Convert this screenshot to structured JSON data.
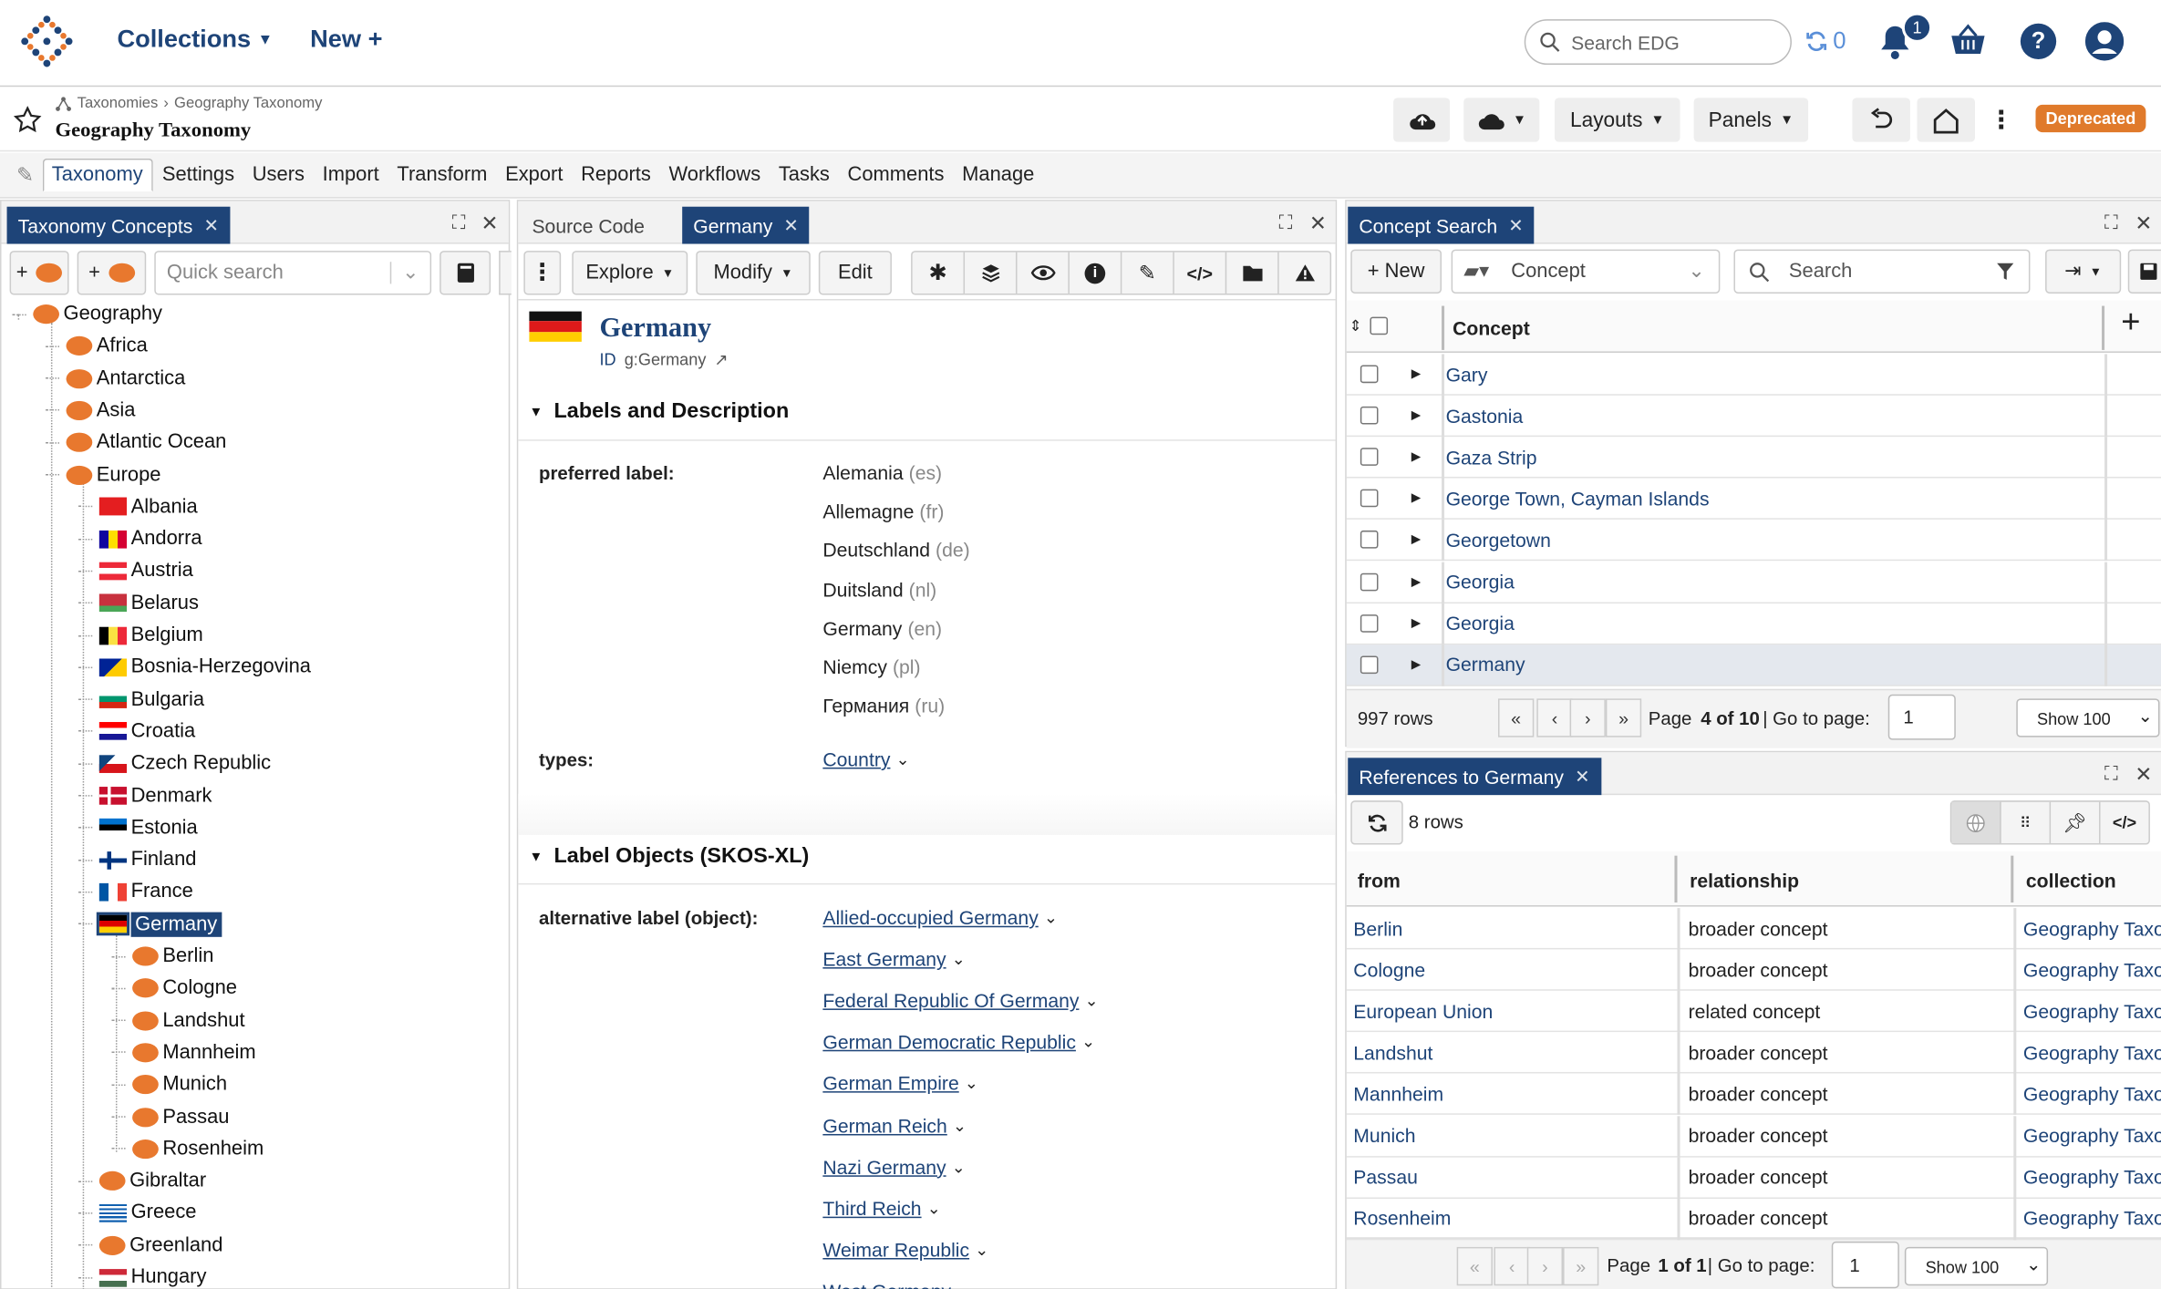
{
  "topbar": {
    "collections_label": "Collections",
    "new_label": "New +",
    "search_placeholder": "Search EDG",
    "sync_count": "0",
    "notification_count": "1"
  },
  "titlebar": {
    "breadcrumb": [
      "Taxonomies",
      "Geography Taxonomy"
    ],
    "title": "Geography Taxonomy",
    "layouts_label": "Layouts",
    "panels_label": "Panels",
    "status_badge": "Deprecated"
  },
  "menubar": {
    "items": [
      "Taxonomy",
      "Settings",
      "Users",
      "Import",
      "Transform",
      "Export",
      "Reports",
      "Workflows",
      "Tasks",
      "Comments",
      "Manage"
    ]
  },
  "tree_panel": {
    "tab_label": "Taxonomy Concepts",
    "quick_search_placeholder": "Quick search",
    "nodes": [
      {
        "label": "Geography",
        "icon": "concept",
        "level": 0
      },
      {
        "label": "Africa",
        "icon": "concept",
        "level": 1
      },
      {
        "label": "Antarctica",
        "icon": "concept",
        "level": 1
      },
      {
        "label": "Asia",
        "icon": "concept",
        "level": 1
      },
      {
        "label": "Atlantic Ocean",
        "icon": "concept",
        "level": 1
      },
      {
        "label": "Europe",
        "icon": "concept",
        "level": 1
      },
      {
        "label": "Albania",
        "icon": "flag-albania",
        "level": 2
      },
      {
        "label": "Andorra",
        "icon": "flag-andorra",
        "level": 2
      },
      {
        "label": "Austria",
        "icon": "flag-austria",
        "level": 2
      },
      {
        "label": "Belarus",
        "icon": "flag-belarus",
        "level": 2
      },
      {
        "label": "Belgium",
        "icon": "flag-belgium",
        "level": 2
      },
      {
        "label": "Bosnia-Herzegovina",
        "icon": "flag-bosnia",
        "level": 2
      },
      {
        "label": "Bulgaria",
        "icon": "flag-bulgaria",
        "level": 2
      },
      {
        "label": "Croatia",
        "icon": "flag-croatia",
        "level": 2
      },
      {
        "label": "Czech Republic",
        "icon": "flag-czech",
        "level": 2
      },
      {
        "label": "Denmark",
        "icon": "flag-denmark",
        "level": 2
      },
      {
        "label": "Estonia",
        "icon": "flag-estonia",
        "level": 2
      },
      {
        "label": "Finland",
        "icon": "flag-finland",
        "level": 2
      },
      {
        "label": "France",
        "icon": "flag-france",
        "level": 2
      },
      {
        "label": "Germany",
        "icon": "flag-germany",
        "level": 2,
        "selected": true
      },
      {
        "label": "Berlin",
        "icon": "concept",
        "level": 3
      },
      {
        "label": "Cologne",
        "icon": "concept",
        "level": 3
      },
      {
        "label": "Landshut",
        "icon": "concept",
        "level": 3
      },
      {
        "label": "Mannheim",
        "icon": "concept",
        "level": 3
      },
      {
        "label": "Munich",
        "icon": "concept",
        "level": 3
      },
      {
        "label": "Passau",
        "icon": "concept",
        "level": 3
      },
      {
        "label": "Rosenheim",
        "icon": "concept",
        "level": 3
      },
      {
        "label": "Gibraltar",
        "icon": "concept",
        "level": 2
      },
      {
        "label": "Greece",
        "icon": "flag-greece",
        "level": 2
      },
      {
        "label": "Greenland",
        "icon": "concept",
        "level": 2
      },
      {
        "label": "Hungary",
        "icon": "flag-hungary",
        "level": 2
      }
    ]
  },
  "detail_panel": {
    "tabs": [
      "Source Code",
      "Germany"
    ],
    "toolbar": {
      "explore": "Explore",
      "modify": "Modify",
      "edit": "Edit"
    },
    "resource_title": "Germany",
    "resource_id_label": "ID",
    "resource_id": "g:Germany",
    "section_labels": "Labels and Description",
    "preferred_label_name": "preferred label:",
    "preferred_labels": [
      {
        "text": "Alemania",
        "lang": "(es)"
      },
      {
        "text": "Allemagne",
        "lang": "(fr)"
      },
      {
        "text": "Deutschland",
        "lang": "(de)"
      },
      {
        "text": "Duitsland",
        "lang": "(nl)"
      },
      {
        "text": "Germany",
        "lang": "(en)"
      },
      {
        "text": "Niemcy",
        "lang": "(pl)"
      },
      {
        "text": "Германия",
        "lang": "(ru)"
      }
    ],
    "types_name": "types:",
    "types_value": "Country",
    "section_label_objects": "Label Objects (SKOS-XL)",
    "alt_label_name": "alternative label (object):",
    "alt_labels": [
      "Allied-occupied Germany",
      "East Germany",
      "Federal Republic Of Germany",
      "German Democratic Republic",
      "German Empire",
      "German Reich",
      "Nazi Germany",
      "Third Reich",
      "Weimar Republic",
      "West Germany"
    ]
  },
  "concept_search": {
    "tab_label": "Concept Search",
    "new_label": "+ New",
    "type_select": "Concept",
    "search_placeholder": "Search",
    "column_header": "Concept",
    "rows": [
      "Gary",
      "Gastonia",
      "Gaza Strip",
      "George Town, Cayman Islands",
      "Georgetown",
      "Georgia",
      "Georgia",
      "Germany"
    ],
    "row_count": "997 rows",
    "page_prefix": "Page",
    "page_info": "4 of 10",
    "goto_label": "| Go to page:",
    "goto_value": "1",
    "show_label": "Show 100"
  },
  "references": {
    "tab_label": "References to Germany",
    "row_count": "8 rows",
    "columns": [
      "from",
      "relationship",
      "collection"
    ],
    "rows": [
      {
        "from": "Berlin",
        "relationship": "broader concept",
        "collection": "Geography Taxonomy"
      },
      {
        "from": "Cologne",
        "relationship": "broader concept",
        "collection": "Geography Taxonomy"
      },
      {
        "from": "European Union",
        "relationship": "related concept",
        "collection": "Geography Taxonomy"
      },
      {
        "from": "Landshut",
        "relationship": "broader concept",
        "collection": "Geography Taxonomy"
      },
      {
        "from": "Mannheim",
        "relationship": "broader concept",
        "collection": "Geography Taxonomy"
      },
      {
        "from": "Munich",
        "relationship": "broader concept",
        "collection": "Geography Taxonomy"
      },
      {
        "from": "Passau",
        "relationship": "broader concept",
        "collection": "Geography Taxonomy"
      },
      {
        "from": "Rosenheim",
        "relationship": "broader concept",
        "collection": "Geography Taxonomy"
      }
    ],
    "page_prefix": "Page",
    "page_info": "1 of 1",
    "goto_label": "| Go to page:",
    "goto_value": "1",
    "show_label": "Show 100"
  },
  "colors": {
    "brand_navy": "#1e4478",
    "accent_orange": "#e8782e",
    "badge_orange": "#e07a2b"
  }
}
